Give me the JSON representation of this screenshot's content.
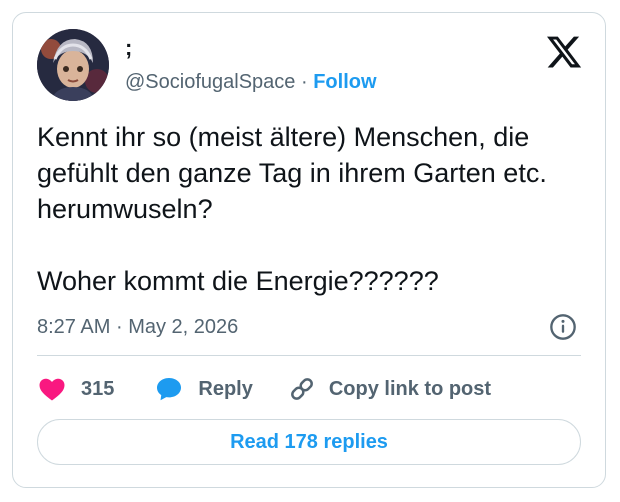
{
  "author": {
    "display_name": ";",
    "handle": "@SociofugalSpace",
    "separator": "·",
    "follow_label": "Follow"
  },
  "tweet": {
    "text": "Kennt ihr so (meist ältere) Menschen, die gefühlt den ganze Tag in ihrem Garten etc. herumwuseln?\n\nWoher kommt die Energie??????",
    "time": "8:27 AM",
    "separator": "·",
    "date": "May 2, 2026"
  },
  "actions": {
    "likes_count": "315",
    "reply_label": "Reply",
    "copy_link_label": "Copy link to post"
  },
  "read_replies_label": "Read 178 replies",
  "icons": {
    "logo": "x-logo-icon",
    "info": "info-icon",
    "like": "heart-icon",
    "reply": "speech-bubble-icon",
    "copy": "link-icon"
  },
  "colors": {
    "accent": "#1d9bf0",
    "like": "#f91880",
    "muted": "#536471",
    "text": "#0f1419",
    "border": "#cfd9de"
  }
}
